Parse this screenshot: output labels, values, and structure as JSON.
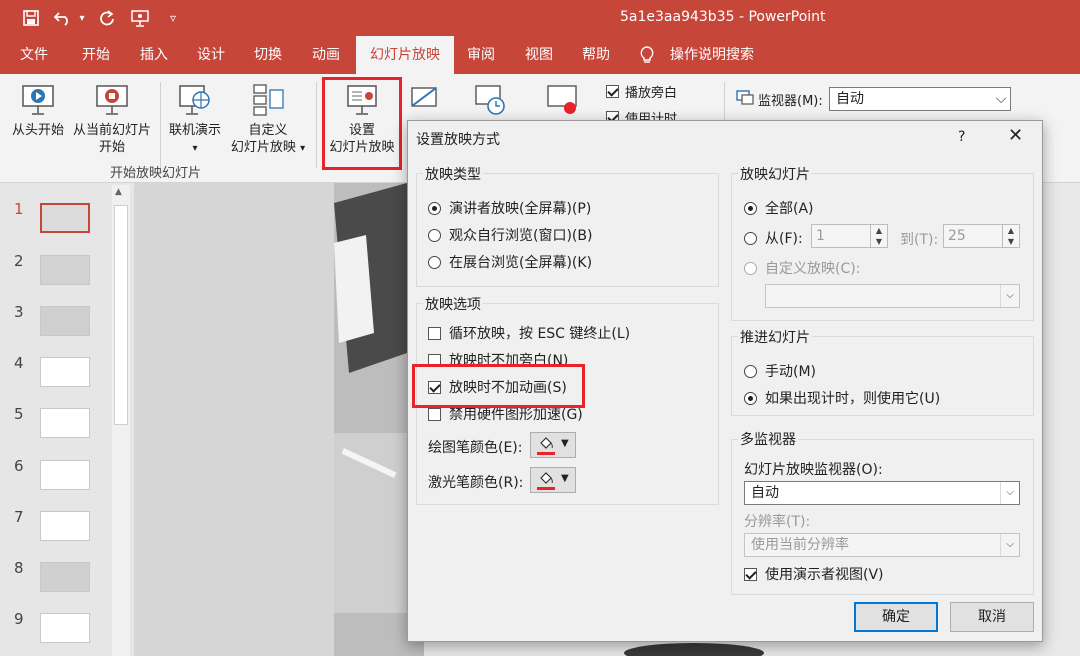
{
  "window": {
    "title": "5a1e3aa943b35  -  PowerPoint"
  },
  "quick_access": {
    "undo_dropdown": "▾",
    "customize": "▿"
  },
  "tabs": [
    "文件",
    "开始",
    "插入",
    "设计",
    "切换",
    "动画",
    "幻灯片放映",
    "审阅",
    "视图",
    "帮助",
    "操作说明搜索"
  ],
  "ribbon": {
    "from_start": "从头开始",
    "from_current_1": "从当前幻灯片",
    "from_current_2": "开始",
    "online": "联机演示",
    "custom_1": "自定义",
    "custom_2": "幻灯片放映",
    "custom_arrow": "▾",
    "online_arrow": "▾",
    "group_label": "开始放映幻灯片",
    "setup_1": "设置",
    "setup_2": "幻灯片放映",
    "narration": "播放旁白",
    "timings": "使用计时",
    "monitor_label": "监视器(M):",
    "monitor_value": "自动"
  },
  "slides": [
    "1",
    "2",
    "3",
    "4",
    "5",
    "6",
    "7",
    "8",
    "9"
  ],
  "dialog": {
    "title": "设置放映方式",
    "help": "?",
    "close": "✕",
    "show_type": {
      "title": "放映类型",
      "options": [
        "演讲者放映(全屏幕)(P)",
        "观众自行浏览(窗口)(B)",
        "在展台浏览(全屏幕)(K)"
      ],
      "selected": 0
    },
    "show_options": {
      "title": "放映选项",
      "items": [
        {
          "label": "循环放映，按 ESC 键终止(L)",
          "checked": false
        },
        {
          "label": "放映时不加旁白(N)",
          "checked": false
        },
        {
          "label": "放映时不加动画(S)",
          "checked": true
        },
        {
          "label": "禁用硬件图形加速(G)",
          "checked": false
        }
      ],
      "pen_color_label": "绘图笔颜色(E):",
      "laser_color_label": "激光笔颜色(R):",
      "pen_color": "#e8232a",
      "laser_color": "#e8232a"
    },
    "show_slides": {
      "title": "放映幻灯片",
      "all": "全部(A)",
      "from": "从(F):",
      "from_value": "1",
      "to": "到(T):",
      "to_value": "25",
      "custom": "自定义放映(C):"
    },
    "advance": {
      "title": "推进幻灯片",
      "manual": "手动(M)",
      "timings": "如果出现计时，则使用它(U)"
    },
    "multi_monitor": {
      "title": "多监视器",
      "monitor_label": "幻灯片放映监视器(O):",
      "monitor_value": "自动",
      "resolution_label": "分辨率(T):",
      "resolution_value": "使用当前分辨率",
      "presenter_view": "使用演示者视图(V)"
    },
    "ok": "确定",
    "cancel": "取消"
  },
  "colors": {
    "brand": "#c6463a",
    "highlight": "#e8232a"
  }
}
